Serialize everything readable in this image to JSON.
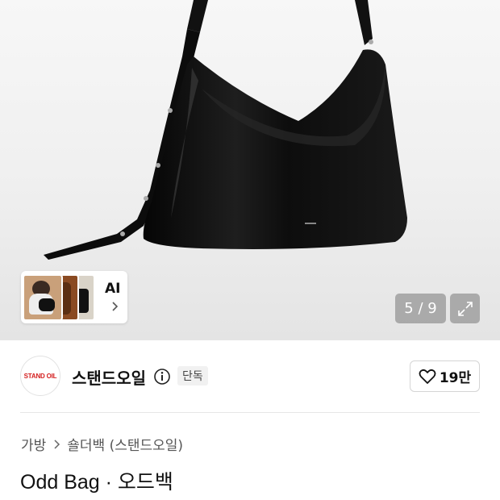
{
  "gallery": {
    "ai_label": "AI",
    "counter": "5 / 9",
    "icons": {
      "ai_chevron": "chevron-right-icon",
      "expand": "expand-icon"
    }
  },
  "brand": {
    "logo_text": "STAND OIL",
    "name": "스탠드오일",
    "badge": "단독",
    "likes": "19만",
    "icons": {
      "info": "info-icon",
      "like": "heart-icon"
    }
  },
  "breadcrumb": {
    "items": [
      "가방",
      "숄더백 (스탠드오일)"
    ],
    "separator_icon": "chevron-right-icon"
  },
  "product": {
    "title": "Odd Bag · 오드백"
  },
  "colors": {
    "brand_logo_text": "#d42020",
    "counter_bg": "#7a7a7a"
  }
}
